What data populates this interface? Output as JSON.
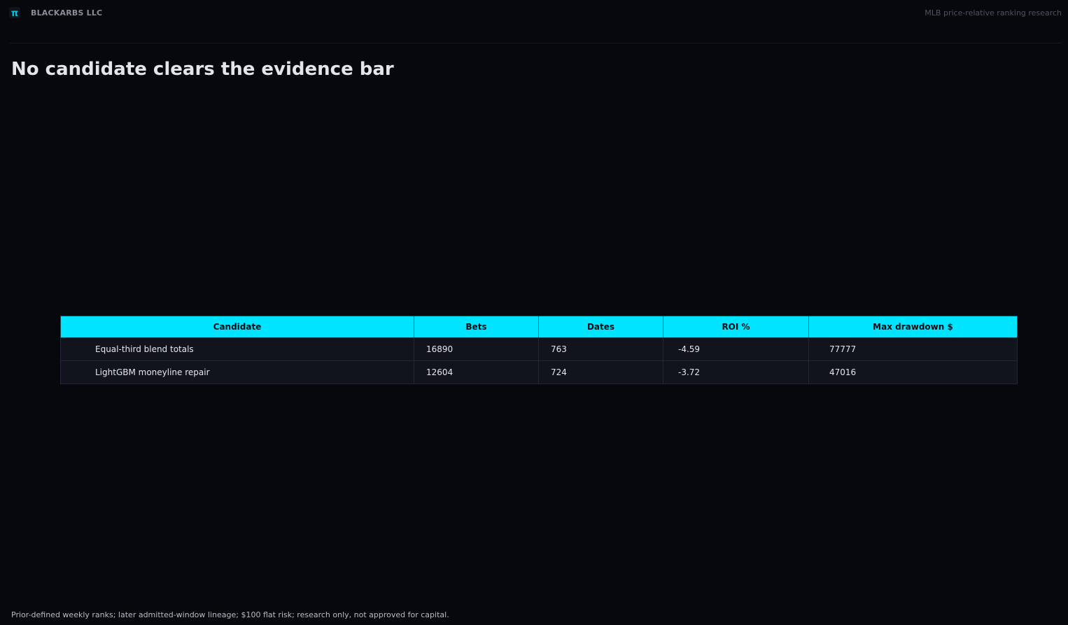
{
  "header": {
    "logo_icon": "pi-icon",
    "logo_glyph": "π",
    "brand": "BLACKARBS LLC",
    "tagline": "MLB price-relative ranking research"
  },
  "title": "No candidate clears the evidence bar",
  "table": {
    "columns": [
      "Candidate",
      "Bets",
      "Dates",
      "ROI %",
      "Max drawdown $"
    ],
    "rows": [
      [
        "Equal-third blend totals",
        "16890",
        "763",
        "-4.59",
        "77777"
      ],
      [
        "LightGBM moneyline repair",
        "12604",
        "724",
        "-3.72",
        "47016"
      ]
    ]
  },
  "footer": "Prior-defined weekly ranks; later admitted-window lineage; $100 flat risk; research only, not approved for capital.",
  "colors": {
    "background": "#07080c",
    "accent": "#00e5ff",
    "row_background": "#11131d"
  }
}
